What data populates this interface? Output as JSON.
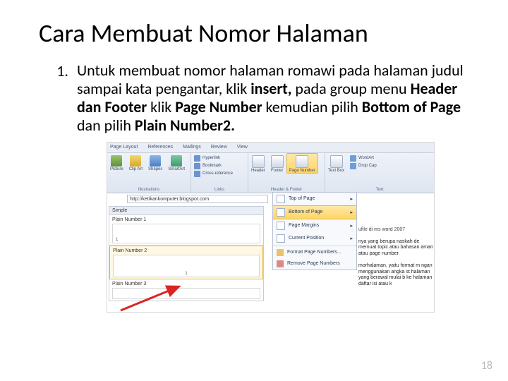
{
  "title": "Cara Membuat Nomor Halaman",
  "list_number": "1.",
  "body_pre": "Untuk membuat nomor halaman romawi pada halaman judul sampai kata pengantar, klik ",
  "bold1": "insert,",
  "body_mid1": " pada group menu ",
  "bold2": "Header dan Footer",
  "body_mid2": " klik ",
  "bold3": "Page Number",
  "body_mid3": " kemudian pilih ",
  "bold4": "Bottom of Page",
  "body_mid4": " dan pilih ",
  "bold5": "Plain Number2.",
  "ribbon": {
    "tabs": [
      "Page Layout",
      "References",
      "Mailings",
      "Review",
      "View"
    ],
    "groups": {
      "illustrations": {
        "label": "Illustrations",
        "items": [
          "Picture",
          "Clip Art",
          "Shapes",
          "SmartArt"
        ]
      },
      "links": {
        "label": "Links",
        "items": [
          "Hyperlink",
          "Bookmark",
          "Cross-reference"
        ]
      },
      "hf": {
        "label": "Header & Footer",
        "items": [
          "Header",
          "Footer",
          "Page Number"
        ]
      },
      "text": {
        "label": "Text",
        "items": [
          "Text Box",
          "WordArt",
          "Drop Cap"
        ]
      }
    }
  },
  "url": "http://ketikankomputer.blogspot.com",
  "gallery": {
    "head": "Simple",
    "items": [
      "Plain Number 1",
      "Plain Number 2",
      "Plain Number 3"
    ]
  },
  "dropdown": {
    "items": [
      "Top of Page",
      "Bottom of Page",
      "Page Margins",
      "Current Position",
      "Format Page Numbers...",
      "Remove Page Numbers"
    ]
  },
  "bg": {
    "title": "ufile di ms word 2007",
    "p1": "nya yang berupa naskah de memuat topic atau bahasan aman atau page number.",
    "p2": "morhalaman, yaitu format m ngan menggunakan angka st halaman yang berawal mulai b ke halaman daftar isi atau k"
  },
  "page_number": "18"
}
